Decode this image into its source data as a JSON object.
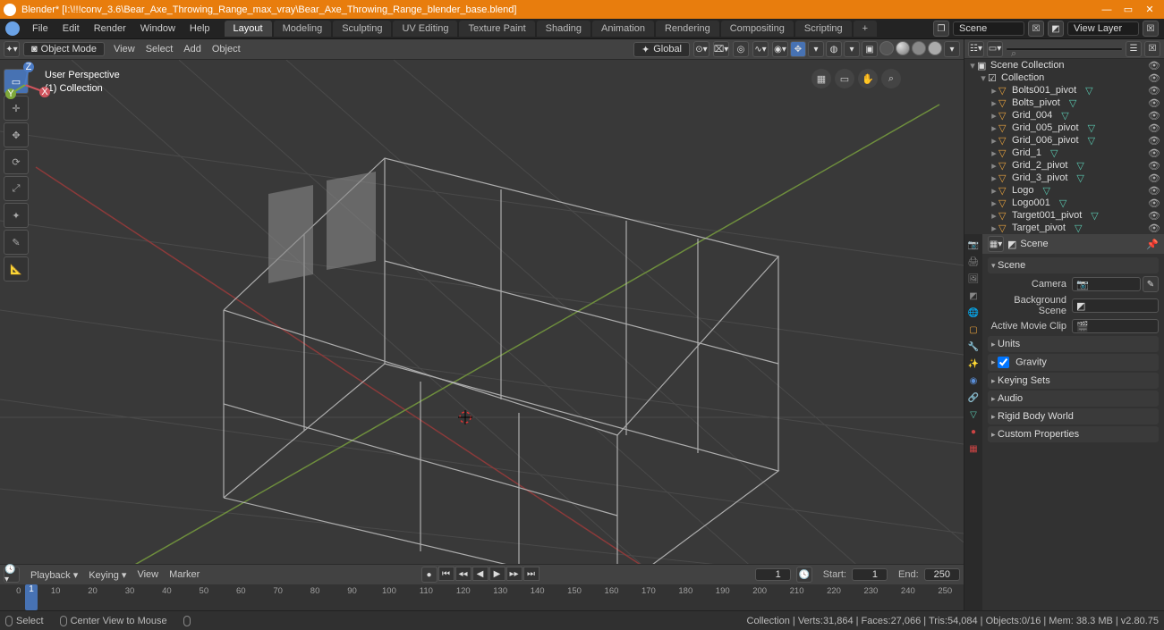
{
  "app_name": "Blender",
  "title": "Blender* [I:\\!!!conv_3.6\\Bear_Axe_Throwing_Range_max_vray\\Bear_Axe_Throwing_Range_blender_base.blend]",
  "file_menu": [
    "File",
    "Edit",
    "Render",
    "Window",
    "Help"
  ],
  "workspaces": [
    "Layout",
    "Modeling",
    "Sculpting",
    "UV Editing",
    "Texture Paint",
    "Shading",
    "Animation",
    "Rendering",
    "Compositing",
    "Scripting",
    "+"
  ],
  "active_workspace": "Layout",
  "scene_name": "Scene",
  "view_layer": "View Layer",
  "vp_mode": "Object Mode",
  "vp_menu": [
    "View",
    "Select",
    "Add",
    "Object"
  ],
  "vp_transform_orientation": "Global",
  "vp_info": {
    "line1": "User Perspective",
    "line2": "(1) Collection"
  },
  "outliner": {
    "root": "Scene Collection",
    "collection": "Collection",
    "items": [
      {
        "name": "Bolts001_pivot",
        "mesh": true
      },
      {
        "name": "Bolts_pivot",
        "mesh": true
      },
      {
        "name": "Grid_004",
        "mesh": true
      },
      {
        "name": "Grid_005_pivot",
        "mesh": true
      },
      {
        "name": "Grid_006_pivot",
        "mesh": true
      },
      {
        "name": "Grid_1",
        "mesh": true
      },
      {
        "name": "Grid_2_pivot",
        "mesh": true
      },
      {
        "name": "Grid_3_pivot",
        "mesh": true
      },
      {
        "name": "Logo",
        "mesh": true
      },
      {
        "name": "Logo001",
        "mesh": true
      },
      {
        "name": "Target001_pivot",
        "mesh": true
      },
      {
        "name": "Target_pivot",
        "mesh": true
      }
    ]
  },
  "props": {
    "context": "Scene",
    "section_scene": "Scene",
    "camera_label": "Camera",
    "camera_value": "",
    "bg_label": "Background Scene",
    "bg_value": "",
    "clip_label": "Active Movie Clip",
    "clip_value": "",
    "sections": [
      "Units",
      "Gravity",
      "Keying Sets",
      "Audio",
      "Rigid Body World",
      "Custom Properties"
    ],
    "gravity_checked": true
  },
  "timeline": {
    "menu": [
      "Playback",
      "Keying",
      "View",
      "Marker"
    ],
    "current": "1",
    "start_label": "Start:",
    "start": "1",
    "end_label": "End:",
    "end": "250",
    "ticks": [
      "0",
      "10",
      "20",
      "30",
      "40",
      "50",
      "60",
      "70",
      "80",
      "90",
      "100",
      "110",
      "120",
      "130",
      "140",
      "150",
      "160",
      "170",
      "180",
      "190",
      "200",
      "210",
      "220",
      "230",
      "240",
      "250"
    ]
  },
  "status": {
    "select": "Select",
    "center": "Center View to Mouse",
    "stats": "Collection | Verts:31,864 | Faces:27,066 | Tris:54,084 | Objects:0/16 | Mem: 38.3 MB | v2.80.75"
  }
}
